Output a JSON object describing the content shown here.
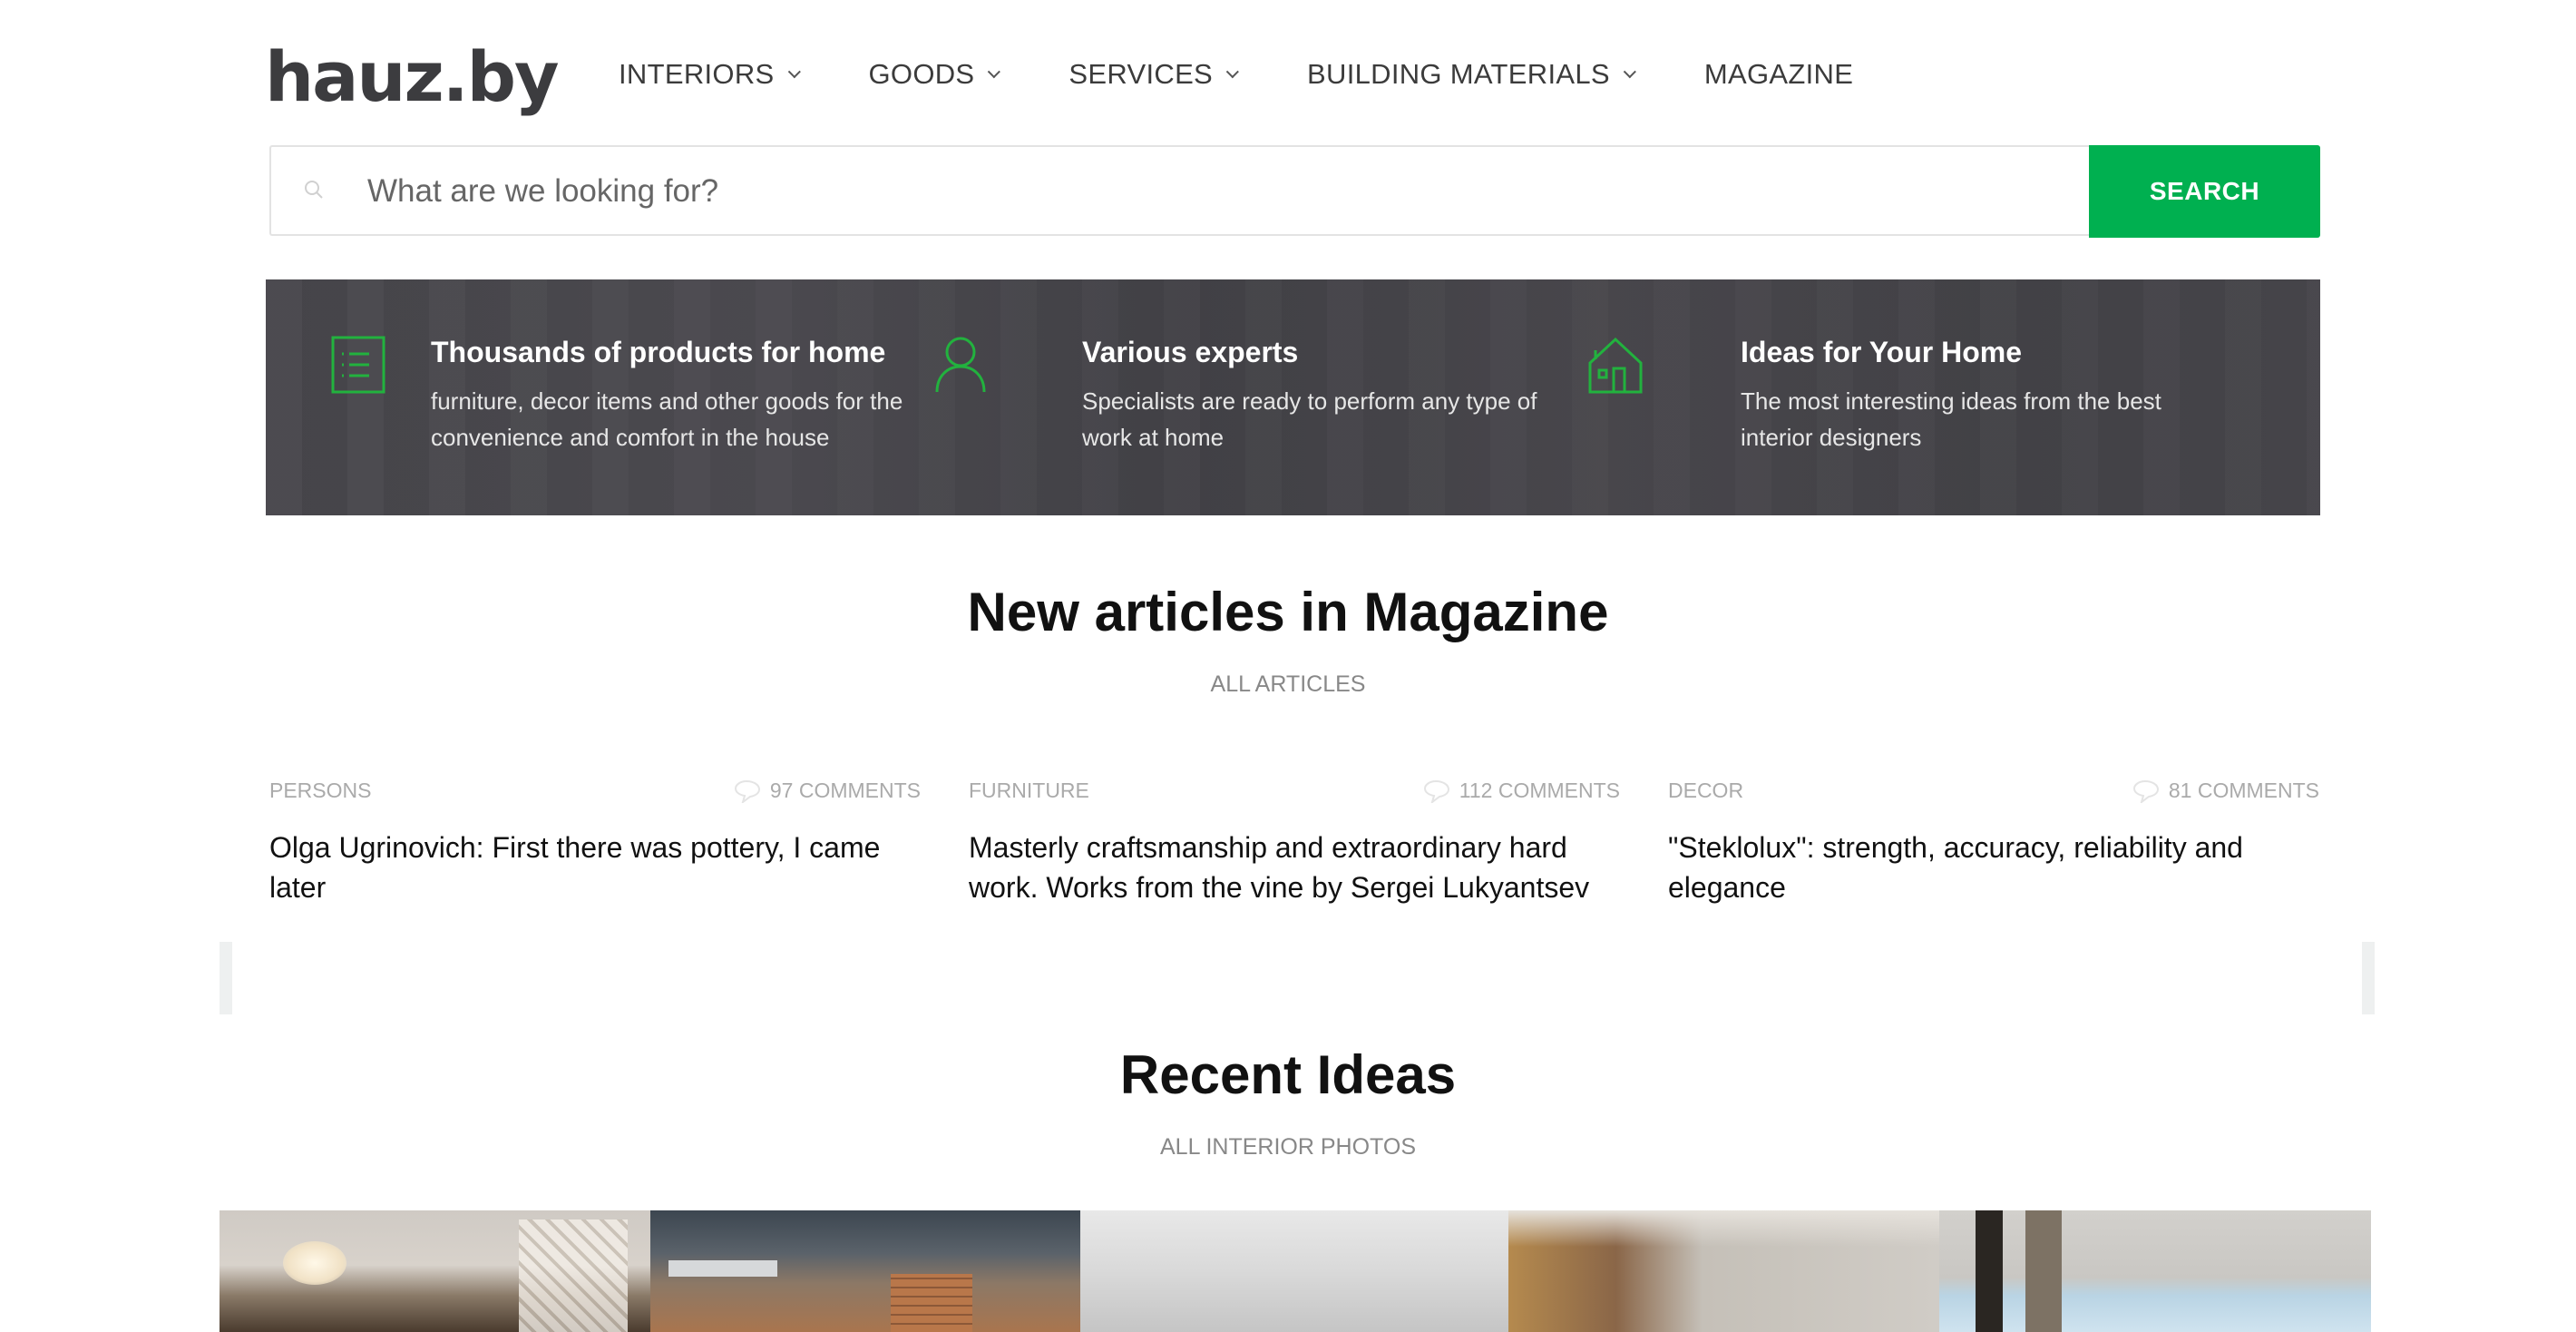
{
  "header": {
    "logo_text": "hauz.by",
    "nav": [
      {
        "label": "INTERIORS",
        "has_dropdown": true
      },
      {
        "label": "GOODS",
        "has_dropdown": true
      },
      {
        "label": "SERVICES",
        "has_dropdown": true
      },
      {
        "label": "BUILDING MATERIALS",
        "has_dropdown": true
      },
      {
        "label": "MAGAZINE",
        "has_dropdown": false
      }
    ]
  },
  "search": {
    "placeholder": "What are we looking for?",
    "value": "",
    "button_label": "SEARCH",
    "icon": "search-icon"
  },
  "colors": {
    "brand_green": "#00b050",
    "banner_bg": "#48474c",
    "text_dark": "#111111",
    "text_muted": "#888888"
  },
  "features": [
    {
      "icon": "list-document-icon",
      "title": "Thousands of products for home",
      "description": "furniture, decor items and other goods for the convenience and comfort in the house"
    },
    {
      "icon": "person-icon",
      "title": "Various experts",
      "description": "Specialists are ready to perform any type of work at home"
    },
    {
      "icon": "house-icon",
      "title": "Ideas for Your Home",
      "description": "The most interesting ideas from the best interior designers"
    }
  ],
  "magazine": {
    "title": "New articles in Magazine",
    "link": "ALL ARTICLES",
    "articles": [
      {
        "category": "PERSONS",
        "comments": "97 COMMENTS",
        "title": "Olga Ugrinovich: First there was pottery, I came later"
      },
      {
        "category": "FURNITURE",
        "comments": "112 COMMENTS",
        "title": "Masterly craftsmanship and extraordinary hard work. Works from the vine by Sergei Lukyantsev"
      },
      {
        "category": "DECOR",
        "comments": "81 COMMENTS",
        "title": "\"Steklolux\": strength, accuracy, reliability and elegance"
      }
    ]
  },
  "ideas": {
    "title": "Recent Ideas",
    "link": "ALL INTERIOR PHOTOS",
    "photos": [
      {
        "subject": "ceiling light and paper chandelier"
      },
      {
        "subject": "loft ceiling with brick wall and track lights"
      },
      {
        "subject": "white minimalist ceiling"
      },
      {
        "subject": "concrete wall with brick and curtains"
      },
      {
        "subject": "wood ceiling with panoramic windows"
      }
    ]
  }
}
